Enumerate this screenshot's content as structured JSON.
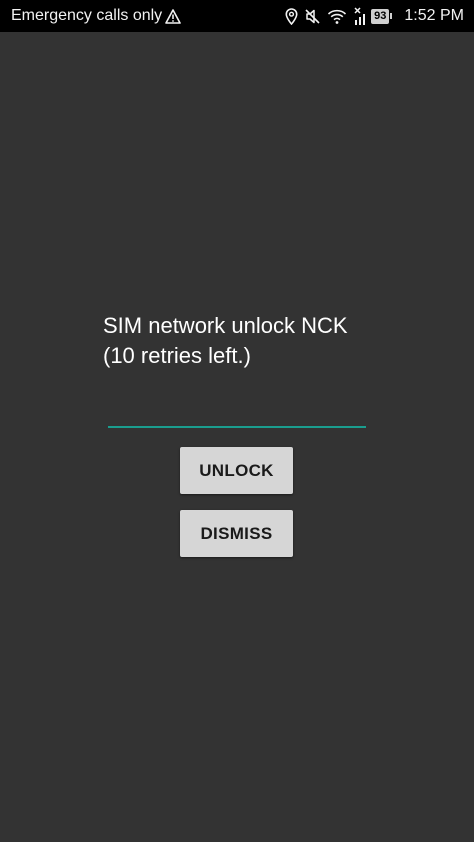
{
  "status_bar": {
    "carrier_text": "Emergency calls only",
    "battery_level": "93",
    "time": "1:52 PM",
    "icons": [
      "warning-icon",
      "location-icon",
      "mute-icon",
      "wifi-icon",
      "no-sim-icon",
      "battery-icon"
    ]
  },
  "dialog": {
    "prompt_line1": "SIM network unlock NCK",
    "prompt_line2": "(10 retries left.)",
    "pin_value": "",
    "unlock_label": "UNLOCK",
    "dismiss_label": "DISMISS"
  },
  "colors": {
    "background": "#333333",
    "status_bar": "#000000",
    "accent": "#1a9e8f",
    "button": "#d6d6d6"
  }
}
